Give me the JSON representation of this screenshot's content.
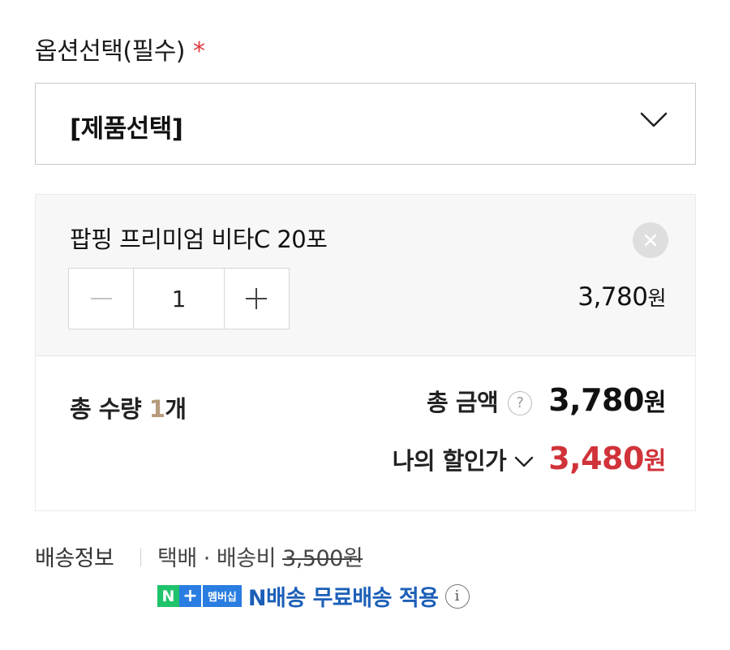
{
  "option": {
    "label": "옵션선택(필수)",
    "required_mark": "*",
    "select_value": "[제품선택]",
    "chevron_icon": "chevron-down-icon"
  },
  "product": {
    "name": "팝핑 프리미엄 비타C 20포",
    "remove_icon": "close-icon",
    "quantity": "1",
    "minus_icon": "minus-icon",
    "plus_icon": "plus-icon",
    "price": "3,780",
    "currency": "원"
  },
  "summary": {
    "total_qty_label": "총 수량 ",
    "total_qty_count": "1",
    "total_qty_unit": "개",
    "total_amount_label": "총 금액",
    "help_icon": "?",
    "total_amount_value": "3,780",
    "discount_label": "나의 할인가",
    "discount_value": "3,480",
    "currency": "원"
  },
  "shipping": {
    "label": "배송정보",
    "method": "택배 · 배송비 ",
    "fee": "3,500원",
    "badge_n": "N",
    "badge_plus": "+",
    "badge_member": "멤버십",
    "free_shipping_text": "N배송 무료배송 적용",
    "info_icon": "i"
  },
  "colors": {
    "required": "#e03a3e",
    "discount_price": "#d0333a",
    "quantity_highlight": "#b59a7b",
    "badge_green": "#1fc36b",
    "badge_blue": "#2a7de1",
    "free_shipping_text": "#1c5fb8"
  }
}
